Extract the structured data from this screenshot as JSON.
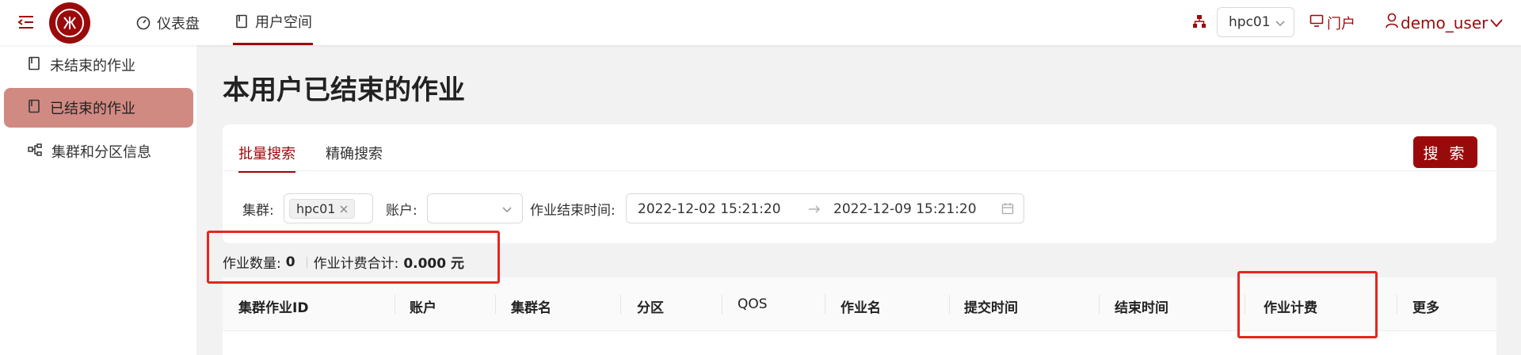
{
  "header": {
    "nav": [
      {
        "label": "仪表盘",
        "icon": "dashboard-icon"
      },
      {
        "label": "用户空间",
        "icon": "book-icon"
      }
    ],
    "cluster_value": "hpc01",
    "portal_label": "门户",
    "user_label": "demo_user"
  },
  "sidebar": {
    "items": [
      {
        "label": "未结束的作业",
        "icon": "book-icon"
      },
      {
        "label": "已结束的作业",
        "icon": "book-icon",
        "active": true
      },
      {
        "label": "集群和分区信息",
        "icon": "cluster-icon"
      }
    ]
  },
  "page": {
    "title": "本用户已结束的作业"
  },
  "search": {
    "tabs": [
      "批量搜索",
      "精确搜索"
    ],
    "active_tab": "批量搜索",
    "button_label": "搜 索",
    "cluster_label": "集群:",
    "cluster_tag": "hpc01",
    "account_label": "账户:",
    "account_value": "",
    "time_label": "作业结束时间:",
    "start_time": "2022-12-02 15:21:20",
    "end_time": "2022-12-09 15:21:20"
  },
  "summary": {
    "count_label": "作业数量:",
    "count_value": "0",
    "cost_label": "作业计费合计:",
    "cost_value": "0.000 元"
  },
  "table": {
    "columns": [
      "集群作业ID",
      "账户",
      "集群名",
      "分区",
      "QOS",
      "作业名",
      "提交时间",
      "结束时间",
      "作业计费",
      "更多"
    ]
  },
  "colors": {
    "accent": "#9b0a0a",
    "sidebar_active": "#d18a82",
    "annotation": "#e8251f"
  }
}
